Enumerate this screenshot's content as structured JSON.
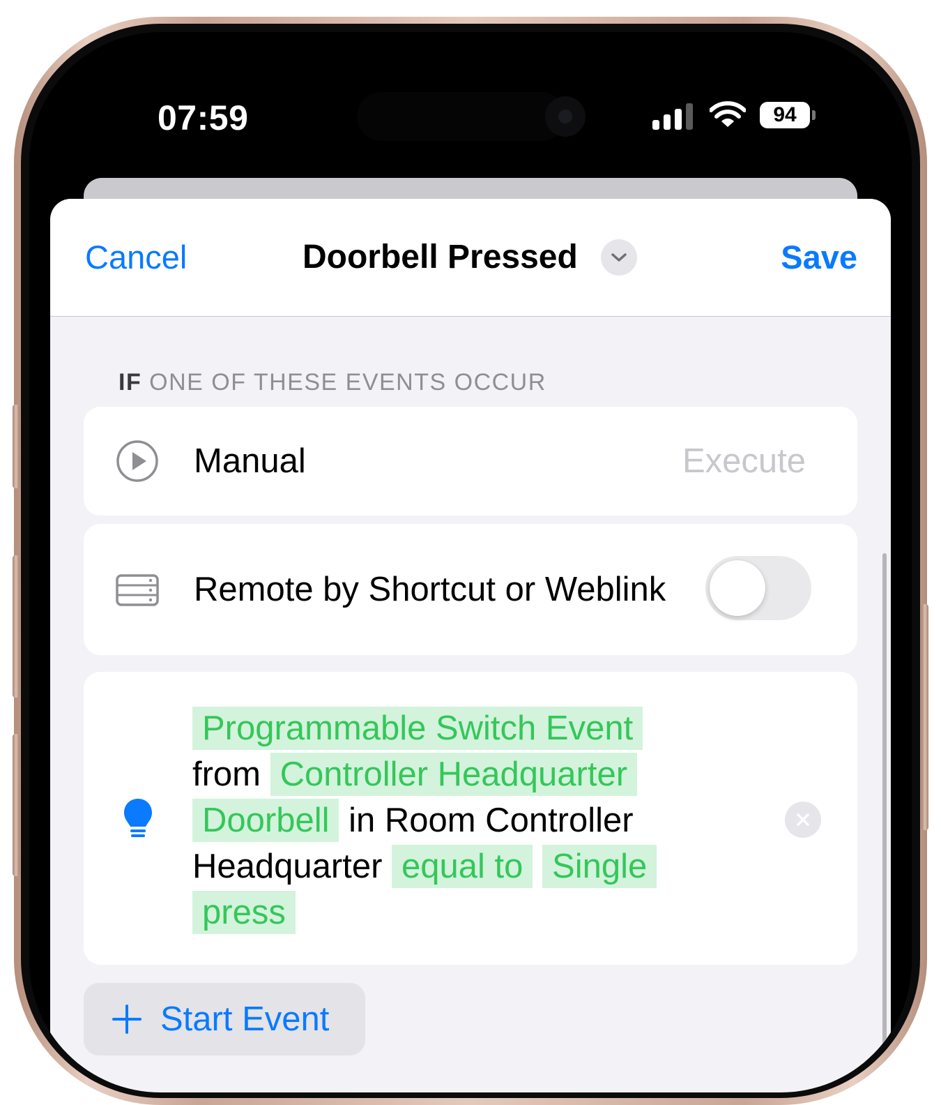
{
  "status_bar": {
    "time": "07:59",
    "battery": "94",
    "icons": [
      "signal-icon",
      "wifi-icon",
      "battery-icon"
    ]
  },
  "nav": {
    "cancel_label": "Cancel",
    "title": "Doorbell Pressed",
    "save_label": "Save",
    "chevron_icon": "chevron-down-icon"
  },
  "section": {
    "if_label": "IF",
    "title": "ONE OF THESE EVENTS OCCUR"
  },
  "events": {
    "manual": {
      "icon": "play-circle-icon",
      "label": "Manual",
      "action": "Execute"
    },
    "remote": {
      "icon": "server-icon",
      "label": "Remote by Shortcut or Weblink",
      "toggle_on": false
    },
    "switch_event": {
      "icon": "lightbulb-icon",
      "event_type": "Programmable Switch Event",
      "from_text": "from",
      "device": "Controller Headquarter Doorbell",
      "room_text": "in Room Controller Headquarter",
      "operator": "equal to",
      "value": "Single press",
      "clear_icon": "clear-icon"
    }
  },
  "start_event": {
    "icon": "plus-icon",
    "label": "Start Event"
  },
  "colors": {
    "accent": "#0a7aff",
    "token_text": "#34c759",
    "token_bg": "#d3f3dc",
    "background": "#f2f2f7"
  }
}
